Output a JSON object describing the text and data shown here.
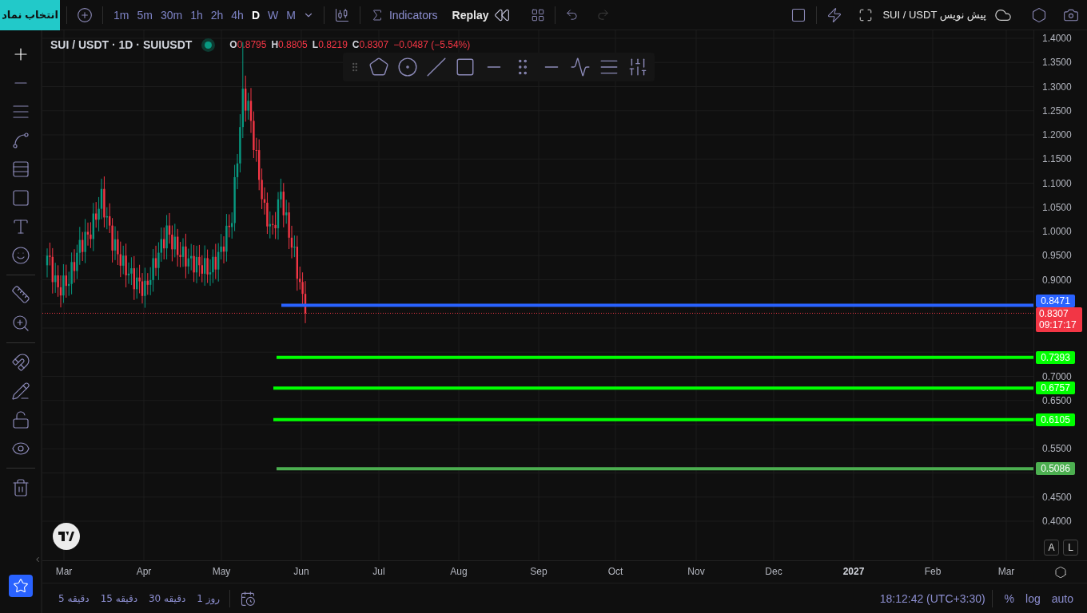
{
  "top_bar": {
    "symbol_button": "انتخاب نماد",
    "intervals": [
      {
        "label": "1m",
        "selected": false
      },
      {
        "label": "5m",
        "selected": false
      },
      {
        "label": "30m",
        "selected": false
      },
      {
        "label": "1h",
        "selected": false
      },
      {
        "label": "2h",
        "selected": false
      },
      {
        "label": "4h",
        "selected": false
      },
      {
        "label": "D",
        "selected": true
      },
      {
        "label": "W",
        "selected": false
      },
      {
        "label": "M",
        "selected": false
      }
    ],
    "indicators": "Indicators",
    "replay": "Replay",
    "layout_name": "SUI / USDT پیش نویس"
  },
  "legend": {
    "title": "SUI / USDT · 1D · SUIUSDT",
    "ohlc": [
      {
        "key": "O",
        "value": "0.8795"
      },
      {
        "key": "H",
        "value": "0.8805"
      },
      {
        "key": "L",
        "value": "0.8219"
      },
      {
        "key": "C",
        "value": "0.8307"
      }
    ],
    "change": "−0.0487 (−5.54%)"
  },
  "price_scale": {
    "ticks": [
      "1.4000",
      "1.3500",
      "1.3000",
      "1.2500",
      "1.2000",
      "1.1500",
      "1.1000",
      "1.0500",
      "1.0000",
      "0.9500",
      "0.9000",
      "0.7000",
      "0.6500",
      "0.5500",
      "0.4500",
      "0.4000"
    ],
    "current_price": {
      "value": "0.8307",
      "countdown": "09:17:17"
    },
    "buttons": [
      "A",
      "L"
    ]
  },
  "horizontal_lines": [
    {
      "label": "0.8471",
      "color": "#2962ff"
    },
    {
      "label": "0.7393",
      "color": "#00ff00"
    },
    {
      "label": "0.6757",
      "color": "#00ff00"
    },
    {
      "label": "0.6105",
      "color": "#00ff00"
    },
    {
      "label": "0.5086",
      "color": "#4caf50"
    }
  ],
  "time_axis": [
    {
      "label": "Mar",
      "kind": "month"
    },
    {
      "label": "Apr",
      "kind": "month"
    },
    {
      "label": "May",
      "kind": "month"
    },
    {
      "label": "Jun",
      "kind": "month"
    },
    {
      "label": "Jul",
      "kind": "month"
    },
    {
      "label": "Aug",
      "kind": "month"
    },
    {
      "label": "Sep",
      "kind": "month"
    },
    {
      "label": "Oct",
      "kind": "month"
    },
    {
      "label": "Nov",
      "kind": "month"
    },
    {
      "label": "Dec",
      "kind": "month"
    },
    {
      "label": "2027",
      "kind": "year"
    },
    {
      "label": "Feb",
      "kind": "month"
    },
    {
      "label": "Mar",
      "kind": "month"
    }
  ],
  "bottom_bar": {
    "ranges": [
      "1 روز",
      "30 دقیقه",
      "15 دقیقه",
      "5 دقیقه"
    ],
    "clock": "18:12:42 (UTC+3:30)",
    "options": [
      "%",
      "log",
      "auto"
    ]
  }
}
